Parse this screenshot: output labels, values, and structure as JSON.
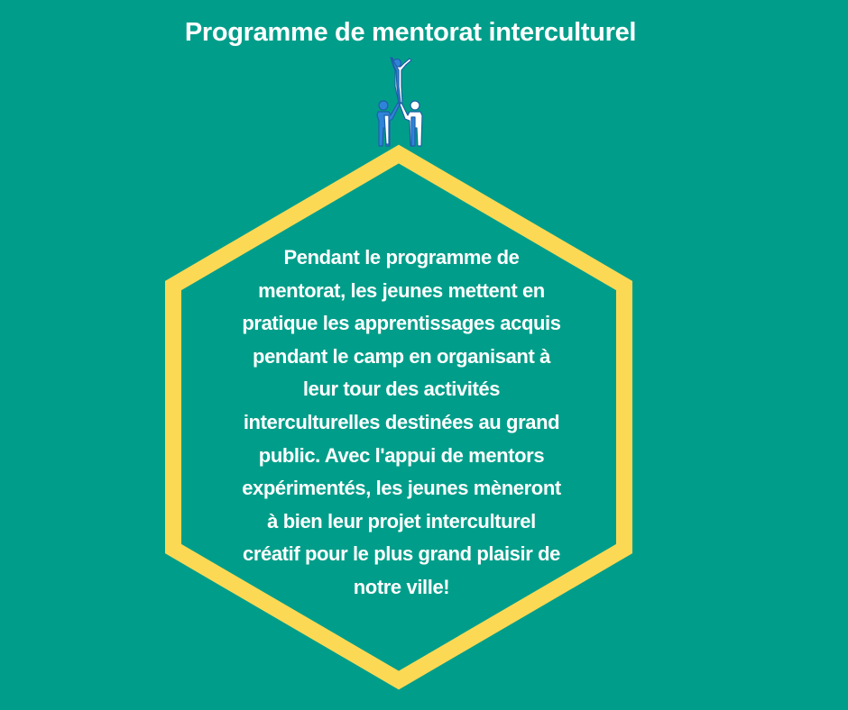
{
  "title": "Programme de mentorat interculturel",
  "body": "Pendant le programme de\nmentorat, les jeunes mettent en\npratique les apprentissages acquis\npendant le camp en organisant à\nleur tour des activités\ninterculturelles destinées au grand\npublic. Avec l'appui de mentors\nexpérimentés, les jeunes mèneront\nà bien leur projet interculturel\ncréatif  pour le plus grand plaisir de\nnotre ville!",
  "icon": "human-pyramid-icon",
  "colors": {
    "background": "#009E8A",
    "hexagon_outline": "#FCD955",
    "text": "#FFFFFF",
    "figure_blue": "#2F84D9",
    "figure_white": "#FFFFFF"
  }
}
